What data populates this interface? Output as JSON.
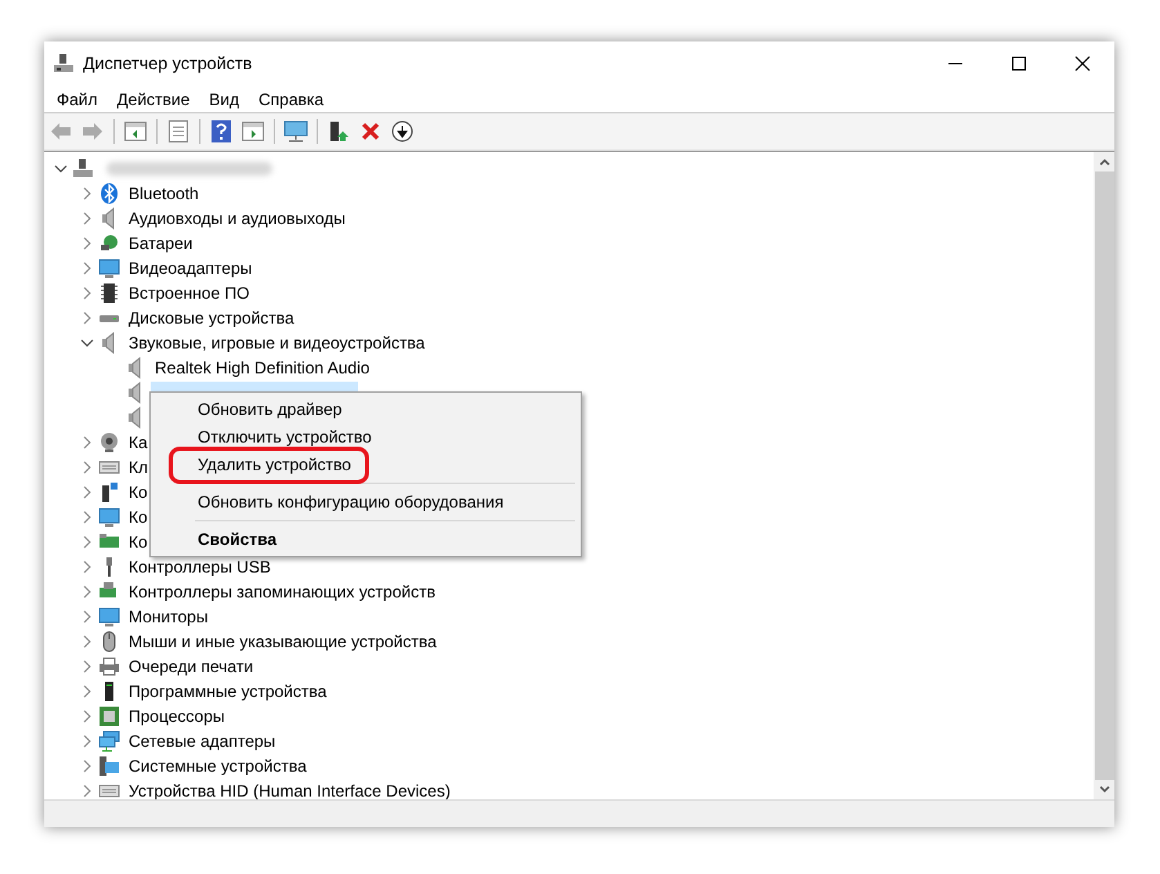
{
  "window": {
    "title": "Диспетчер устройств"
  },
  "menu": [
    {
      "label": "Файл"
    },
    {
      "label": "Действие"
    },
    {
      "label": "Вид"
    },
    {
      "label": "Справка"
    }
  ],
  "tree": [
    {
      "expanded": true,
      "selected": false,
      "children": [
        {
          "label": "Bluetooth",
          "expanded": false,
          "selected": false
        },
        {
          "label": "Аудиовходы и аудиовыходы",
          "expanded": false,
          "selected": false
        },
        {
          "label": "Батареи",
          "expanded": false,
          "selected": false
        },
        {
          "label": "Видеоадаптеры",
          "expanded": false,
          "selected": false
        },
        {
          "label": "Встроенное ПО",
          "expanded": false,
          "selected": false
        },
        {
          "label": "Дисковые устройства",
          "expanded": false,
          "selected": false
        },
        {
          "label": "Звуковые, игровые и видеоустройства",
          "expanded": true,
          "selected": false,
          "children": [
            {
              "label": "Realtek High Definition Audio",
              "selected": false
            },
            {
              "selected": true
            },
            {
              "selected": false
            }
          ]
        },
        {
          "label": "Ка",
          "expanded": false,
          "selected": false
        },
        {
          "label": "Кл",
          "expanded": false,
          "selected": false
        },
        {
          "label": "Ко",
          "expanded": false,
          "selected": false
        },
        {
          "label": "Ко",
          "expanded": false,
          "selected": false
        },
        {
          "label": "Ко",
          "expanded": false,
          "selected": false
        },
        {
          "label": "Контроллеры USB",
          "expanded": false,
          "selected": false
        },
        {
          "label": "Контроллеры запоминающих устройств",
          "expanded": false,
          "selected": false
        },
        {
          "label": "Мониторы",
          "expanded": false,
          "selected": false
        },
        {
          "label": "Мыши и иные указывающие устройства",
          "expanded": false,
          "selected": false
        },
        {
          "label": "Очереди печати",
          "expanded": false,
          "selected": false
        },
        {
          "label": "Программные устройства",
          "expanded": false,
          "selected": false
        },
        {
          "label": "Процессоры",
          "expanded": false,
          "selected": false
        },
        {
          "label": "Сетевые адаптеры",
          "expanded": false,
          "selected": false
        },
        {
          "label": "Системные устройства",
          "expanded": false,
          "selected": false
        },
        {
          "label": "Устройства HID (Human Interface Devices)",
          "expanded": false,
          "selected": false
        }
      ]
    }
  ],
  "context_menu": [
    {
      "kind": "item",
      "label": "Обновить драйвер",
      "highlighted": false
    },
    {
      "kind": "item",
      "label": "Отключить устройство",
      "highlighted": false
    },
    {
      "kind": "item",
      "label": "Удалить устройство",
      "highlighted": true
    },
    {
      "kind": "separator"
    },
    {
      "kind": "item",
      "label": "Обновить конфигурацию оборудования",
      "highlighted": false
    },
    {
      "kind": "separator"
    },
    {
      "kind": "default",
      "label": "Свойства",
      "highlighted": false
    }
  ]
}
